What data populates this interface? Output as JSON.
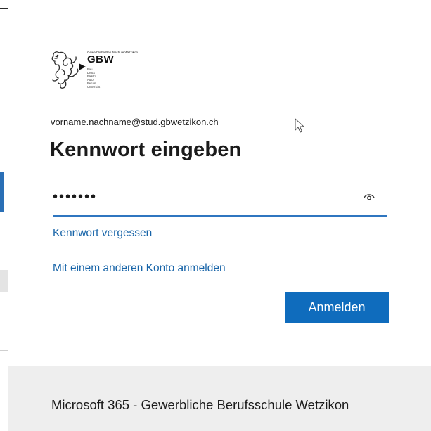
{
  "logo": {
    "school_small": "Gewerbliche Berufsschule Wetzikon",
    "abbreviation": "GBW",
    "lines": [
      "Bau",
      "Druck",
      "Elektro",
      "Auto",
      "Berufs",
      "Unterricht"
    ]
  },
  "account": {
    "email": "vorname.nachname@stud.gbwetzikon.ch"
  },
  "title": "Kennwort eingeben",
  "password": {
    "masked_value": "•••••••",
    "reveal_icon": "eye-icon"
  },
  "links": {
    "forgot_password": "Kennwort vergessen",
    "other_account": "Mit einem anderen Konto anmelden"
  },
  "signin_button": "Anmelden",
  "footer": {
    "text": "Microsoft 365 - Gewerbliche Berufsschule Wetzikon"
  },
  "colors": {
    "accent": "#0f6cbd",
    "link": "#1764a8",
    "footer_bg": "#eeeeee"
  }
}
